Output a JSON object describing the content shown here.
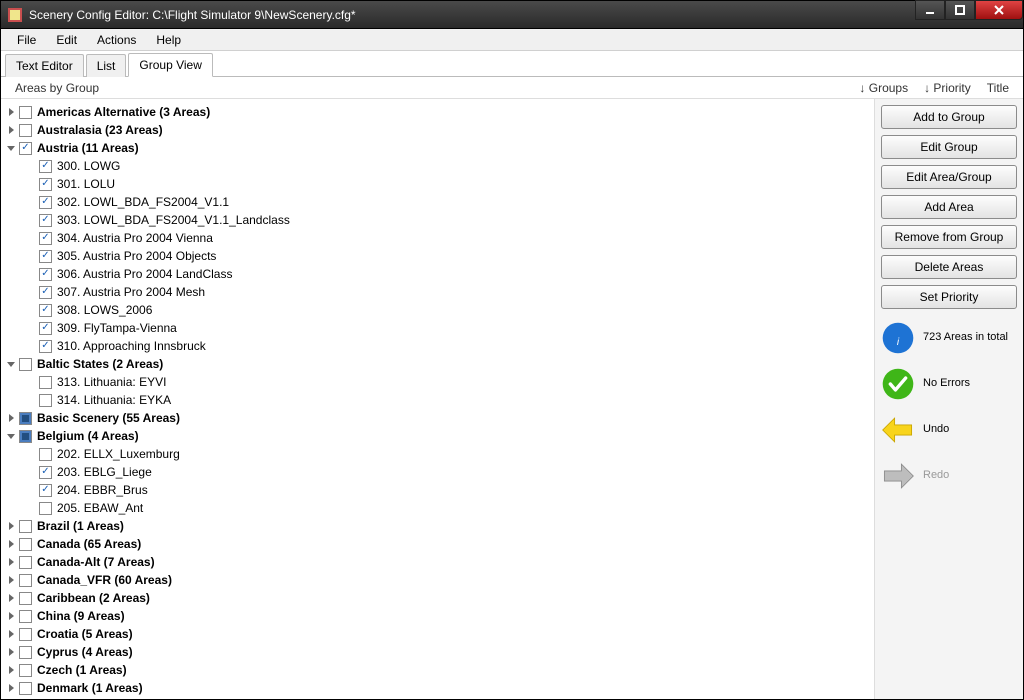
{
  "window": {
    "title": "Scenery Config Editor: C:\\Flight Simulator 9\\NewScenery.cfg*"
  },
  "menu": {
    "file": "File",
    "edit": "Edit",
    "actions": "Actions",
    "help": "Help"
  },
  "tabs": {
    "text": "Text Editor",
    "list": "List",
    "group": "Group View"
  },
  "header": {
    "left": "Areas by Group",
    "groups": "↓ Groups",
    "priority": "↓ Priority",
    "title": "Title"
  },
  "buttons": {
    "addToGroup": "Add to Group",
    "editGroup": "Edit Group",
    "editAreaGroup": "Edit Area/Group",
    "addArea": "Add Area",
    "removeFromGroup": "Remove from Group",
    "deleteAreas": "Delete Areas",
    "setPriority": "Set Priority"
  },
  "status": {
    "info": "723 Areas in total",
    "ok": "No Errors",
    "undo": "Undo",
    "redo": "Redo"
  },
  "tree": [
    {
      "label": "Americas Alternative (3 Areas)",
      "bold": true,
      "check": "unchecked",
      "expand": "closed"
    },
    {
      "label": "Australasia (23 Areas)",
      "bold": true,
      "check": "unchecked",
      "expand": "closed"
    },
    {
      "label": "Austria (11 Areas)",
      "bold": true,
      "check": "checked",
      "expand": "open",
      "children": [
        {
          "label": "300. LOWG",
          "check": "checked"
        },
        {
          "label": "301. LOLU",
          "check": "checked"
        },
        {
          "label": "302. LOWL_BDA_FS2004_V1.1",
          "check": "checked"
        },
        {
          "label": "303. LOWL_BDA_FS2004_V1.1_Landclass",
          "check": "checked"
        },
        {
          "label": "304. Austria Pro 2004 Vienna",
          "check": "checked"
        },
        {
          "label": "305. Austria Pro 2004 Objects",
          "check": "checked"
        },
        {
          "label": "306. Austria Pro 2004 LandClass",
          "check": "checked"
        },
        {
          "label": "307. Austria Pro 2004 Mesh",
          "check": "checked"
        },
        {
          "label": "308. LOWS_2006",
          "check": "checked"
        },
        {
          "label": "309. FlyTampa-Vienna",
          "check": "checked"
        },
        {
          "label": "310. Approaching Innsbruck",
          "check": "checked"
        }
      ]
    },
    {
      "label": "Baltic States (2 Areas)",
      "bold": true,
      "check": "unchecked",
      "expand": "open",
      "children": [
        {
          "label": "313. Lithuania: EYVI",
          "check": "unchecked"
        },
        {
          "label": "314. Lithuania: EYKA",
          "check": "unchecked"
        }
      ]
    },
    {
      "label": "Basic Scenery (55 Areas)",
      "bold": true,
      "check": "mixed",
      "expand": "closed"
    },
    {
      "label": "Belgium (4 Areas)",
      "bold": true,
      "check": "mixed",
      "expand": "open",
      "children": [
        {
          "label": "202. ELLX_Luxemburg",
          "check": "unchecked"
        },
        {
          "label": "203. EBLG_Liege",
          "check": "checked"
        },
        {
          "label": "204. EBBR_Brus",
          "check": "checked"
        },
        {
          "label": "205. EBAW_Ant",
          "check": "unchecked"
        }
      ]
    },
    {
      "label": "Brazil (1 Areas)",
      "bold": true,
      "check": "unchecked",
      "expand": "closed"
    },
    {
      "label": "Canada (65 Areas)",
      "bold": true,
      "check": "unchecked",
      "expand": "closed"
    },
    {
      "label": "Canada-Alt (7 Areas)",
      "bold": true,
      "check": "unchecked",
      "expand": "closed"
    },
    {
      "label": "Canada_VFR (60 Areas)",
      "bold": true,
      "check": "unchecked",
      "expand": "closed"
    },
    {
      "label": "Caribbean (2 Areas)",
      "bold": true,
      "check": "unchecked",
      "expand": "closed"
    },
    {
      "label": "China (9 Areas)",
      "bold": true,
      "check": "unchecked",
      "expand": "closed"
    },
    {
      "label": "Croatia (5 Areas)",
      "bold": true,
      "check": "unchecked",
      "expand": "closed"
    },
    {
      "label": "Cyprus (4 Areas)",
      "bold": true,
      "check": "unchecked",
      "expand": "closed"
    },
    {
      "label": "Czech (1 Areas)",
      "bold": true,
      "check": "unchecked",
      "expand": "closed"
    },
    {
      "label": "Denmark (1 Areas)",
      "bold": true,
      "check": "unchecked",
      "expand": "closed"
    }
  ]
}
